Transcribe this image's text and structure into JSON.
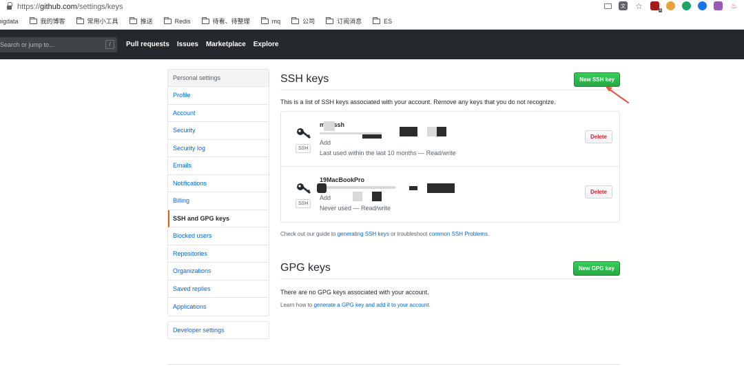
{
  "browser": {
    "url_scheme": "https://",
    "url_host": "github.com",
    "url_path": "/settings/keys",
    "bookmarks": [
      "bigdata",
      "我的博客",
      "常用小工具",
      "推送",
      "Redis",
      "待看、待整理",
      "mq",
      "公司",
      "订阅消息",
      "ES"
    ],
    "ext_badge": "3"
  },
  "header": {
    "search_placeholder": "Search or jump to...",
    "search_key": "/",
    "nav": [
      "Pull requests",
      "Issues",
      "Marketplace",
      "Explore"
    ]
  },
  "sidebar": {
    "heading": "Personal settings",
    "items": [
      "Profile",
      "Account",
      "Security",
      "Security log",
      "Emails",
      "Notifications",
      "Billing",
      "SSH and GPG keys",
      "Blocked users",
      "Repositories",
      "Organizations",
      "Saved replies",
      "Applications"
    ],
    "active_index": 7,
    "developer": "Developer settings"
  },
  "ssh": {
    "title": "SSH keys",
    "new_button": "New SSH key",
    "description": "This is a list of SSH keys associated with your account. Remove any keys that you do not recognize.",
    "keys": [
      {
        "name": "mac ssh",
        "badge": "SSH",
        "added": "Add",
        "usage": "Last used within the last 10 months — Read/write",
        "delete": "Delete"
      },
      {
        "name": "19MacBookPro",
        "badge": "SSH",
        "added": "Add",
        "usage": "Never used — Read/write",
        "delete": "Delete"
      }
    ],
    "guide_prefix": "Check out our guide to ",
    "guide_link1": "generating SSH keys",
    "guide_middle": " or troubleshoot ",
    "guide_link2": "common SSH Problems",
    "guide_suffix": "."
  },
  "gpg": {
    "title": "GPG keys",
    "new_button": "New GPG key",
    "empty": "There are no GPG keys associated with your account.",
    "learn_prefix": "Learn how to ",
    "learn_link": "generate a GPG key and add it to your account",
    "learn_suffix": "."
  },
  "colors": {
    "header_bg": "#24292e",
    "link": "#0366d6",
    "green": "#28a745",
    "delete": "#cb2431",
    "arrow": "#e8553f",
    "active_border": "#e36209"
  }
}
